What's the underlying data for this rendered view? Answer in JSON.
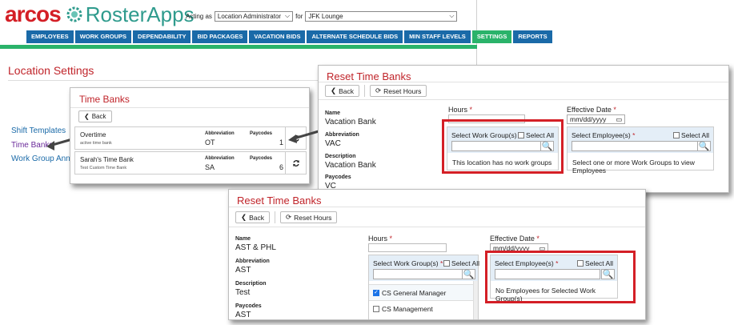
{
  "app": {
    "brand_red": "arcos",
    "brand_teal": "RosterApps",
    "acting_as_label": "Acting as",
    "role_value": "Location Administrator",
    "for_label": "for",
    "location_value": "JFK Lounge",
    "nav": [
      "EMPLOYEES",
      "WORK GROUPS",
      "DEPENDABILITY",
      "BID PACKAGES",
      "VACATION BIDS",
      "ALTERNATE SCHEDULE BIDS",
      "MIN STAFF LEVELS",
      "SETTINGS",
      "REPORTS"
    ],
    "active_nav": "SETTINGS",
    "page_title": "Location Settings",
    "side_links": [
      "Shift Templates",
      "Time Banks",
      "Work Group Announ"
    ]
  },
  "time_banks": {
    "title": "Time Banks",
    "back_label": "Back",
    "abbreviation_header": "Abbreviation",
    "paycodes_header": "Paycodes",
    "rows": [
      {
        "name": "Overtime",
        "subtitle": "active time bank",
        "abbreviation": "OT",
        "paycodes": "1"
      },
      {
        "name": "Sarah's Time Bank",
        "subtitle": "Test Custom Time Bank",
        "abbreviation": "SA",
        "paycodes": "6"
      }
    ]
  },
  "reset_top": {
    "title": "Reset Time Banks",
    "back_label": "Back",
    "reset_label": "Reset Hours",
    "name_label": "Name",
    "name_value": "Vacation Bank",
    "abbr_label": "Abbreviation",
    "abbr_value": "VAC",
    "desc_label": "Description",
    "desc_value": "Vacation Bank",
    "paycodes_label": "Paycodes",
    "paycodes_value": "VC",
    "hours_label": "Hours",
    "effective_label": "Effective Date",
    "date_placeholder": "mm/dd/yyyy",
    "workgroups_label": "Select Work Group(s)",
    "select_all": "Select All",
    "workgroups_msg": "This location has no work groups",
    "employees_label": "Select Employee(s)",
    "employees_msg": "Select one or more Work Groups to view Employees"
  },
  "reset_bottom": {
    "title": "Reset Time Banks",
    "back_label": "Back",
    "reset_label": "Reset Hours",
    "name_label": "Name",
    "name_value": "AST & PHL",
    "abbr_label": "Abbreviation",
    "abbr_value": "AST",
    "desc_label": "Description",
    "desc_value": "Test",
    "paycodes_label": "Paycodes",
    "paycodes_value": "AST",
    "hours_label": "Hours",
    "effective_label": "Effective Date",
    "date_placeholder": "mm/dd/yyyy",
    "workgroups_label": "Select Work Group(s)",
    "select_all": "Select All",
    "workgroup_items": [
      {
        "label": "CS General Manager",
        "checked": true
      },
      {
        "label": "CS Management",
        "checked": false
      }
    ],
    "employees_label": "Select Employee(s)",
    "employees_msg": "No Employees for Selected Work Group(s)"
  },
  "required_mark": "*",
  "colors": {
    "brand_red": "#d41f26",
    "brand_teal": "#2f9b8d",
    "nav_blue": "#1a6aa8",
    "accent_green": "#2ab36a",
    "highlight_red": "#d41f26"
  }
}
